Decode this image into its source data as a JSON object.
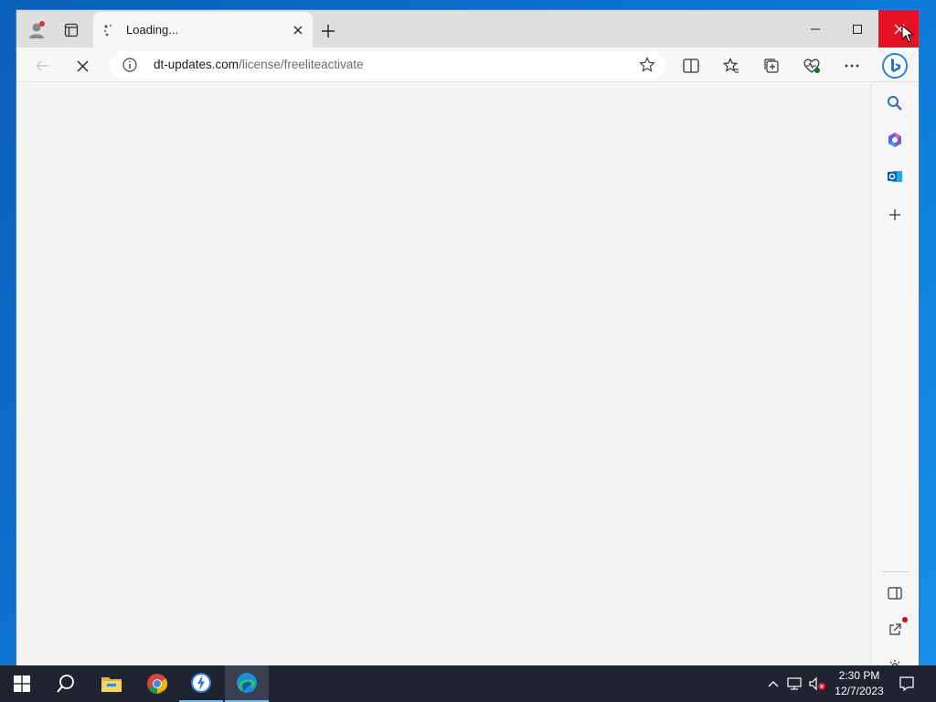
{
  "browser": {
    "tab": {
      "title": "Loading..."
    },
    "address": {
      "host": "dt-updates.com",
      "path": "/license/freeliteactivate"
    }
  },
  "taskbar": {
    "clock": {
      "time": "2:30 PM",
      "date": "12/7/2023"
    }
  },
  "colors": {
    "close_red": "#e81123",
    "taskbar_bg": "#1f2430",
    "desktop_blue": "#0c78d8"
  },
  "icons": [
    "profile-icon",
    "tab-actions-icon",
    "loading-spinner-icon",
    "close-icon",
    "plus-icon",
    "minimize-icon",
    "maximize-icon",
    "back-arrow-icon",
    "stop-icon",
    "info-icon",
    "star-icon",
    "split-screen-icon",
    "favorites-icon",
    "collections-icon",
    "browser-essentials-icon",
    "more-icon",
    "bing-icon",
    "search-icon",
    "copilot-icon",
    "outlook-icon",
    "hide-sidebar-icon",
    "external-link-icon",
    "settings-gear-icon",
    "windows-start-icon",
    "file-explorer-icon",
    "chrome-icon",
    "edge-icon",
    "chevron-up-icon",
    "network-icon",
    "volume-muted-icon",
    "notification-icon",
    "mouse-cursor-icon"
  ]
}
